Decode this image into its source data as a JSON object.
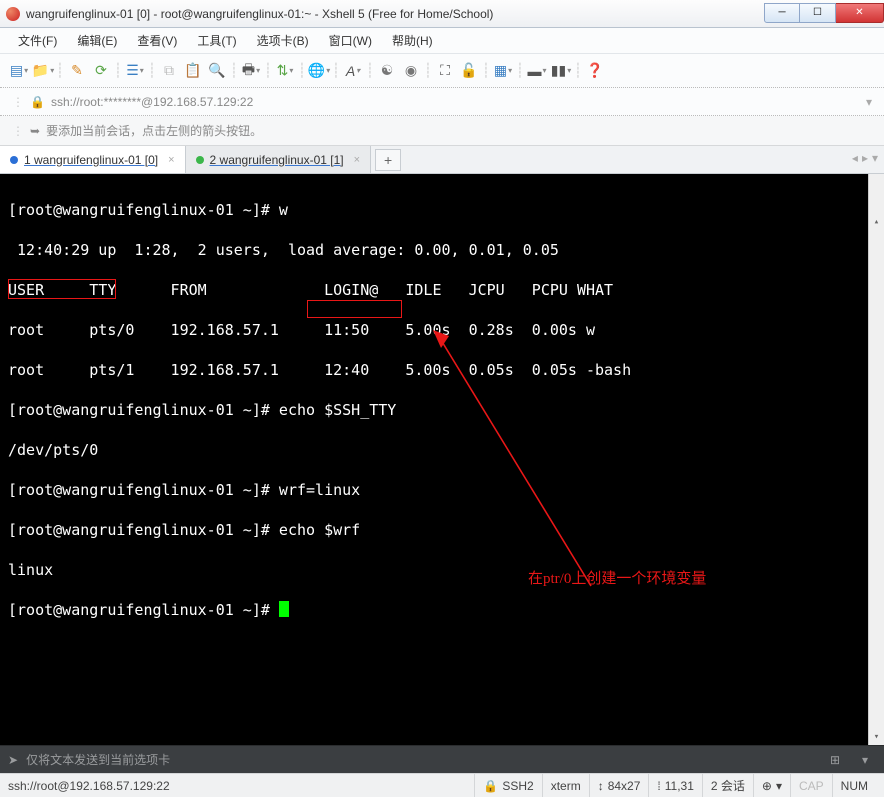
{
  "window": {
    "title": "wangruifenglinux-01 [0] - root@wangruifenglinux-01:~ - Xshell 5 (Free for Home/School)"
  },
  "menu": {
    "items": [
      "文件(F)",
      "编辑(E)",
      "查看(V)",
      "工具(T)",
      "选项卡(B)",
      "窗口(W)",
      "帮助(H)"
    ]
  },
  "address": {
    "url": "ssh://root:********@192.168.57.129:22"
  },
  "hint": {
    "text": "要添加当前会话，点击左侧的箭头按钮。"
  },
  "tabs": {
    "items": [
      {
        "label": "1 wangruifenglinux-01 [0]",
        "active": true
      },
      {
        "label": "2 wangruifenglinux-01 [1]",
        "active": false
      }
    ]
  },
  "terminal": {
    "lines": [
      "[root@wangruifenglinux-01 ~]# w",
      " 12:40:29 up  1:28,  2 users,  load average: 0.00, 0.01, 0.05",
      "USER     TTY      FROM             LOGIN@   IDLE   JCPU   PCPU WHAT",
      "root     pts/0    192.168.57.1     11:50    5.00s  0.28s  0.00s w",
      "root     pts/1    192.168.57.1     12:40    5.00s  0.05s  0.05s -bash",
      "[root@wangruifenglinux-01 ~]# echo $SSH_TTY",
      "/dev/pts/0",
      "[root@wangruifenglinux-01 ~]# wrf=linux",
      "[root@wangruifenglinux-01 ~]# echo $wrf",
      "linux",
      "[root@wangruifenglinux-01 ~]# "
    ]
  },
  "annotation": {
    "text": "在ptr/0上创建一个环境变量"
  },
  "sendbar": {
    "placeholder": "仅将文本发送到当前选项卡"
  },
  "status": {
    "conn": "ssh://root@192.168.57.129:22",
    "proto": "SSH2",
    "term": "xterm",
    "size": "84x27",
    "pos": "11,31",
    "sessions": "2 会话",
    "cap": "CAP",
    "num": "NUM"
  }
}
